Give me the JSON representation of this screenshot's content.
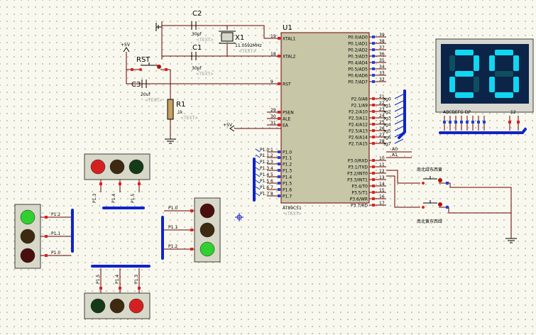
{
  "mcu": {
    "ref": "U1",
    "part": "AT89C51",
    "text_tag": "<TEXT>",
    "left_pins": [
      {
        "num": "19",
        "name": "XTAL1"
      },
      {
        "num": "18",
        "name": "XTAL2"
      },
      {
        "num": "9",
        "name": "RST"
      },
      {
        "num": "29",
        "name": "PSEN"
      },
      {
        "num": "30",
        "name": "ALE"
      },
      {
        "num": "31",
        "name": "EA"
      },
      {
        "num": "1",
        "name": "P1.0"
      },
      {
        "num": "2",
        "name": "P1.1"
      },
      {
        "num": "3",
        "name": "P1.2"
      },
      {
        "num": "4",
        "name": "P1.3"
      },
      {
        "num": "5",
        "name": "P1.4"
      },
      {
        "num": "6",
        "name": "P1.5"
      },
      {
        "num": "7",
        "name": "P1.6"
      },
      {
        "num": "8",
        "name": "P1.7"
      }
    ],
    "right_pins": [
      {
        "num": "39",
        "name": "P0.0/AD0"
      },
      {
        "num": "38",
        "name": "P0.1/AD1"
      },
      {
        "num": "37",
        "name": "P0.2/AD2"
      },
      {
        "num": "36",
        "name": "P0.3/AD3"
      },
      {
        "num": "35",
        "name": "P0.4/AD4"
      },
      {
        "num": "34",
        "name": "P0.5/AD5"
      },
      {
        "num": "33",
        "name": "P0.6/AD6"
      },
      {
        "num": "32",
        "name": "P0.7/AD7"
      },
      {
        "num": "21",
        "name": "P2.0/A8"
      },
      {
        "num": "22",
        "name": "P2.1/A9"
      },
      {
        "num": "23",
        "name": "P2.2/A10"
      },
      {
        "num": "24",
        "name": "P2.3/A11"
      },
      {
        "num": "25",
        "name": "P2.4/A12"
      },
      {
        "num": "26",
        "name": "P2.5/A13"
      },
      {
        "num": "27",
        "name": "P2.6/A14"
      },
      {
        "num": "28",
        "name": "P2.7/A15"
      },
      {
        "num": "10",
        "name": "P3.0/RXD"
      },
      {
        "num": "11",
        "name": "P3.1/TXD"
      },
      {
        "num": "12",
        "name": "P3.2/INT0"
      },
      {
        "num": "13",
        "name": "P3.3/INT1"
      },
      {
        "num": "14",
        "name": "P3.4/T0"
      },
      {
        "num": "15",
        "name": "P3.5/T1"
      },
      {
        "num": "16",
        "name": "P3.6/WR"
      },
      {
        "num": "17",
        "name": "P3.7/RD"
      }
    ],
    "p1_net_labels": [
      "P1.0",
      "P1.1",
      "P1.2",
      "P1.3",
      "P1.4",
      "P1.5",
      "P1.6",
      "P1.7"
    ],
    "p2_net_labels": [
      "sg0",
      "sg1",
      "sg2",
      "sg3",
      "sg4",
      "sg5",
      "sg6",
      "sg7"
    ],
    "p3_net_labels": [
      "A0",
      "A1"
    ]
  },
  "crystal": {
    "ref": "X1",
    "value": "11.0592MHz",
    "tag": "<TEXT>"
  },
  "caps": [
    {
      "ref": "C2",
      "value": "30pf",
      "tag": "<TEXT>"
    },
    {
      "ref": "C1",
      "value": "30pf",
      "tag": "<TEXT>"
    },
    {
      "ref": "C3",
      "value": "20uf",
      "tag": "<TEXT>"
    }
  ],
  "reset_button": {
    "ref": "RST"
  },
  "resistor": {
    "ref": "R1",
    "value": "1k",
    "tag": "<TEXT>"
  },
  "power": {
    "vcc_top": "+5V",
    "vcc_ea": "+5V"
  },
  "display": {
    "digits": "20",
    "segment_label": "ABCDEFG DP",
    "digit_label": "12",
    "on_color": "#11d6f0",
    "off_color": "#0d4f60",
    "bg_color": "#0b2448"
  },
  "switches": [
    {
      "label": "南北绿东西黄"
    },
    {
      "label": "南北黄东西绿"
    }
  ],
  "traffic_lights": {
    "top_horizontal": {
      "colors": [
        "#d42020",
        "#3d2a10",
        "#153a18"
      ],
      "labels": [
        "P1.3",
        "P1.4",
        "P1.5"
      ]
    },
    "left_vertical": {
      "colors": [
        "#2fd02f",
        "#3d2a10",
        "#4a0e0e"
      ],
      "labels": [
        "P1.2",
        "P1.1",
        "P1.0"
      ]
    },
    "center_vertical": {
      "colors": [
        "#4a0e0e",
        "#3d2a10",
        "#2fd02f"
      ],
      "labels": [
        "P1.0",
        "P1.1",
        "P1.2"
      ]
    },
    "bottom_horizontal": {
      "colors": [
        "#153a18",
        "#3d2a10",
        "#d42020"
      ],
      "labels": [
        "P1.5",
        "P1.4",
        "P1.3"
      ]
    }
  },
  "palette": {
    "wire": "#6b0000",
    "bus": "#1024c8",
    "pin_red": "#e02020",
    "pin_blue": "#2040e0",
    "chip_fill": "#c7c7a7"
  }
}
